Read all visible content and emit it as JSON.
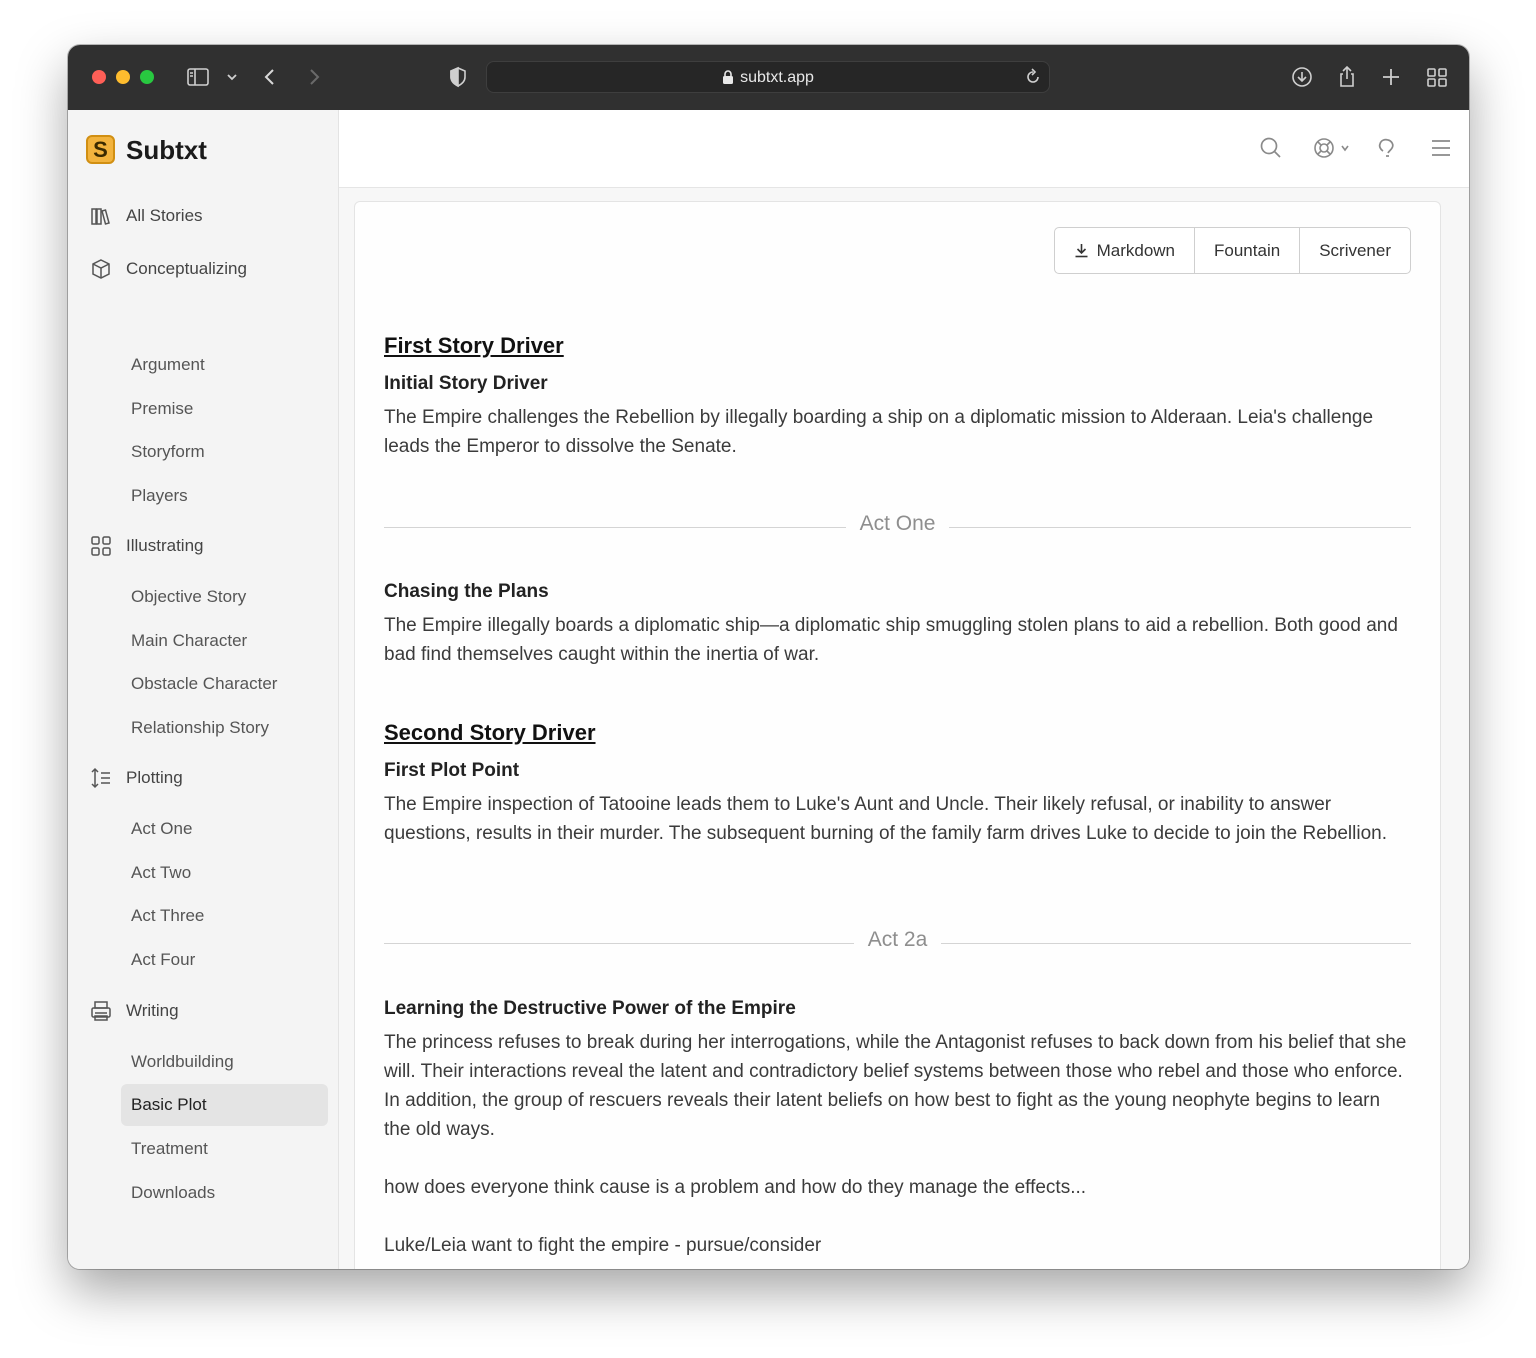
{
  "browser": {
    "url": "subtxt.app"
  },
  "brand": {
    "logo_letter": "S",
    "name": "Subtxt"
  },
  "sidebar": {
    "sections": [
      {
        "label": "All Stories",
        "icon": "books-icon"
      },
      {
        "label": "Conceptualizing",
        "icon": "cube-icon"
      },
      {
        "label": "Illustrating",
        "icon": "grid-icon"
      },
      {
        "label": "Plotting",
        "icon": "list-order-icon"
      },
      {
        "label": "Writing",
        "icon": "printer-icon"
      }
    ],
    "conceptualizing_items": [
      "Argument",
      "Premise",
      "Storyform",
      "Players"
    ],
    "illustrating_items": [
      "Objective Story",
      "Main Character",
      "Obstacle Character",
      "Relationship Story"
    ],
    "plotting_items": [
      "Act One",
      "Act Two",
      "Act Three",
      "Act Four"
    ],
    "writing_items": [
      "Worldbuilding",
      "Basic Plot",
      "Treatment",
      "Downloads"
    ],
    "active_item": "Basic Plot"
  },
  "export": {
    "markdown": "Markdown",
    "fountain": "Fountain",
    "scrivener": "Scrivener"
  },
  "content": {
    "driver1": {
      "title": "First Story Driver",
      "subtitle": "Initial Story Driver",
      "text": "The Empire challenges the Rebellion by illegally boarding a ship on a diplomatic mission to Alderaan. Leia's challenge leads the Emperor to dissolve the Senate."
    },
    "act_one": "Act One",
    "act_one_beat": {
      "title": "Chasing the Plans",
      "text": "The Empire illegally boards a diplomatic ship—a diplomatic ship smuggling stolen plans to aid a rebellion. Both good and bad find themselves caught within the inertia of war."
    },
    "driver2": {
      "title": "Second Story Driver",
      "subtitle": "First Plot Point",
      "text": "The Empire inspection of Tatooine leads them to Luke's Aunt and Uncle. Their likely refusal, or inability to answer questions, results in their murder. The subsequent burning of the family farm drives Luke to decide to join the Rebellion."
    },
    "act_2a": "Act 2a",
    "act_2a_beat": {
      "title": "Learning the Destructive Power of the Empire",
      "text": "The princess refuses to break during her interrogations, while the Antagonist refuses to back down from his belief that she will. Their interactions reveal the latent and contradictory belief systems between those who rebel and those who enforce. In addition, the group of rescuers reveals their latent beliefs on how best to fight as the young neophyte begins to learn the old ways.",
      "note1": "how does everyone think cause is a problem and how do they manage the effects...",
      "note2": "Luke/Leia want to fight the empire - pursue/consider"
    }
  }
}
